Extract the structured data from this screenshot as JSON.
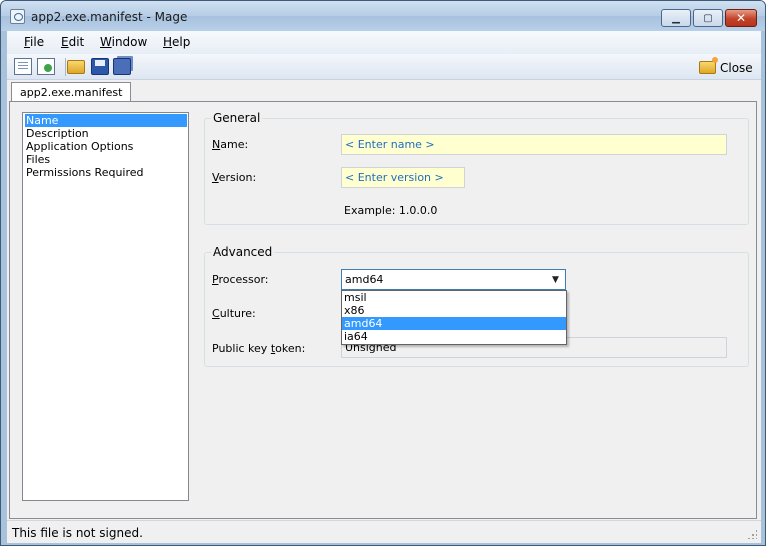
{
  "window": {
    "title": "app2.exe.manifest - Mage",
    "caption_min": "▁",
    "caption_max": "▢",
    "caption_close": "✕"
  },
  "menu": [
    {
      "key": "F",
      "rest": "ile"
    },
    {
      "key": "E",
      "rest": "dit"
    },
    {
      "key": "W",
      "rest": "indow"
    },
    {
      "key": "H",
      "rest": "elp"
    }
  ],
  "toolbar": {
    "icons": [
      "new-document-icon",
      "new-from-icon",
      "open-folder-icon",
      "save-icon",
      "save-all-icon"
    ],
    "close_label": "Close",
    "close_icon": "folder-close-icon"
  },
  "tab": {
    "label": "app2.exe.manifest"
  },
  "nav": {
    "items": [
      "Name",
      "Description",
      "Application Options",
      "Files",
      "Permissions Required"
    ],
    "selected": "Name"
  },
  "general": {
    "label": "General",
    "name_label_key": "N",
    "name_label_rest": "ame:",
    "name_placeholder": "< Enter name >",
    "version_label_key": "V",
    "version_label_rest": "ersion:",
    "version_placeholder": "< Enter version >",
    "example": "Example: 1.0.0.0"
  },
  "advanced": {
    "label": "Advanced",
    "processor_label_key": "P",
    "processor_label_rest": "rocessor:",
    "processor_value": "amd64",
    "processor_options": [
      "msil",
      "x86",
      "amd64",
      "ia64"
    ],
    "culture_label_key": "C",
    "culture_label_rest": "ulture:",
    "public_key_label_pre": "Public key ",
    "public_key_label_key": "t",
    "public_key_label_rest": "oken:",
    "public_key_value": "Unsigned"
  },
  "status": {
    "text": "This file is not signed."
  },
  "colors": {
    "selection": "#3399ff",
    "input_bg": "#ffffcf",
    "placeholder": "#1f6ec0"
  }
}
